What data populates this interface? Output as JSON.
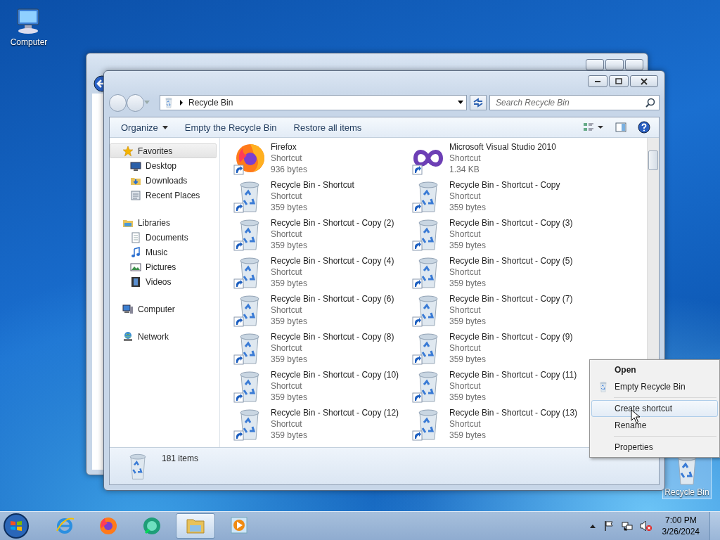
{
  "desktop_icons": [
    {
      "kind": "computer",
      "label": "Computer",
      "selected": false
    },
    {
      "kind": "recycle-bin",
      "label": "Recycle Bin",
      "selected": true
    }
  ],
  "window": {
    "address": "Recycle Bin",
    "search": {
      "placeholder": "Search Recycle Bin"
    },
    "toolbar": [
      {
        "label": "Organize",
        "dropdown": true
      },
      {
        "label": "Empty the Recycle Bin",
        "dropdown": false
      },
      {
        "label": "Restore all items",
        "dropdown": false
      }
    ],
    "nav": [
      {
        "kind": "favorites",
        "label": "Favorites",
        "selected": true,
        "children": [
          {
            "kind": "desktop",
            "label": "Desktop",
            "selected": false
          },
          {
            "kind": "downloads",
            "label": "Downloads",
            "selected": false
          },
          {
            "kind": "recent",
            "label": "Recent Places",
            "selected": false
          }
        ]
      },
      {
        "kind": "libraries",
        "label": "Libraries",
        "selected": false,
        "children": [
          {
            "kind": "documents",
            "label": "Documents",
            "selected": false
          },
          {
            "kind": "music",
            "label": "Music",
            "selected": false
          },
          {
            "kind": "pictures",
            "label": "Pictures",
            "selected": false
          },
          {
            "kind": "videos",
            "label": "Videos",
            "selected": false
          }
        ]
      },
      {
        "kind": "computer",
        "label": "Computer",
        "selected": false
      },
      {
        "kind": "network",
        "label": "Network",
        "selected": false
      }
    ],
    "items": [
      {
        "kind": "firefox",
        "name": "Firefox",
        "type": "Shortcut",
        "size": "936 bytes"
      },
      {
        "kind": "visual-studio",
        "name": "Microsoft Visual Studio 2010",
        "type": "Shortcut",
        "size": "1.34 KB"
      },
      {
        "kind": "recycle-bin",
        "name": "Recycle Bin - Shortcut",
        "type": "Shortcut",
        "size": "359 bytes"
      },
      {
        "kind": "recycle-bin",
        "name": "Recycle Bin - Shortcut - Copy",
        "type": "Shortcut",
        "size": "359 bytes"
      },
      {
        "kind": "recycle-bin",
        "name": "Recycle Bin - Shortcut - Copy (2)",
        "type": "Shortcut",
        "size": "359 bytes"
      },
      {
        "kind": "recycle-bin",
        "name": "Recycle Bin - Shortcut - Copy (3)",
        "type": "Shortcut",
        "size": "359 bytes"
      },
      {
        "kind": "recycle-bin",
        "name": "Recycle Bin - Shortcut - Copy (4)",
        "type": "Shortcut",
        "size": "359 bytes"
      },
      {
        "kind": "recycle-bin",
        "name": "Recycle Bin - Shortcut - Copy (5)",
        "type": "Shortcut",
        "size": "359 bytes"
      },
      {
        "kind": "recycle-bin",
        "name": "Recycle Bin - Shortcut - Copy (6)",
        "type": "Shortcut",
        "size": "359 bytes"
      },
      {
        "kind": "recycle-bin",
        "name": "Recycle Bin - Shortcut - Copy (7)",
        "type": "Shortcut",
        "size": "359 bytes"
      },
      {
        "kind": "recycle-bin",
        "name": "Recycle Bin - Shortcut - Copy (8)",
        "type": "Shortcut",
        "size": "359 bytes"
      },
      {
        "kind": "recycle-bin",
        "name": "Recycle Bin - Shortcut - Copy (9)",
        "type": "Shortcut",
        "size": "359 bytes"
      },
      {
        "kind": "recycle-bin",
        "name": "Recycle Bin - Shortcut - Copy (10)",
        "type": "Shortcut",
        "size": "359 bytes"
      },
      {
        "kind": "recycle-bin",
        "name": "Recycle Bin - Shortcut - Copy (11)",
        "type": "Shortcut",
        "size": "359 bytes"
      },
      {
        "kind": "recycle-bin",
        "name": "Recycle Bin - Shortcut - Copy (12)",
        "type": "Shortcut",
        "size": "359 bytes"
      },
      {
        "kind": "recycle-bin",
        "name": "Recycle Bin - Shortcut - Copy (13)",
        "type": "Shortcut",
        "size": "359 bytes"
      }
    ],
    "status": "181 items"
  },
  "context_menu": {
    "groups": [
      [
        {
          "label": "Open",
          "kind": "default",
          "icon": false,
          "selected": false
        },
        {
          "label": "Empty Recycle Bin",
          "kind": "normal",
          "icon": true,
          "selected": false
        }
      ],
      [
        {
          "label": "Create shortcut",
          "kind": "normal",
          "icon": false,
          "selected": true
        },
        {
          "label": "Rename",
          "kind": "normal",
          "icon": false,
          "selected": false
        }
      ],
      [
        {
          "label": "Properties",
          "kind": "normal",
          "icon": false,
          "selected": false
        }
      ]
    ]
  },
  "taskbar": {
    "apps": [
      {
        "kind": "ie",
        "active": false
      },
      {
        "kind": "firefox",
        "active": false
      },
      {
        "kind": "green-app",
        "active": false
      },
      {
        "kind": "explorer",
        "active": true
      },
      {
        "kind": "media",
        "active": false
      }
    ],
    "tray": {
      "time": "7:00 PM",
      "date": "3/26/2024"
    }
  }
}
